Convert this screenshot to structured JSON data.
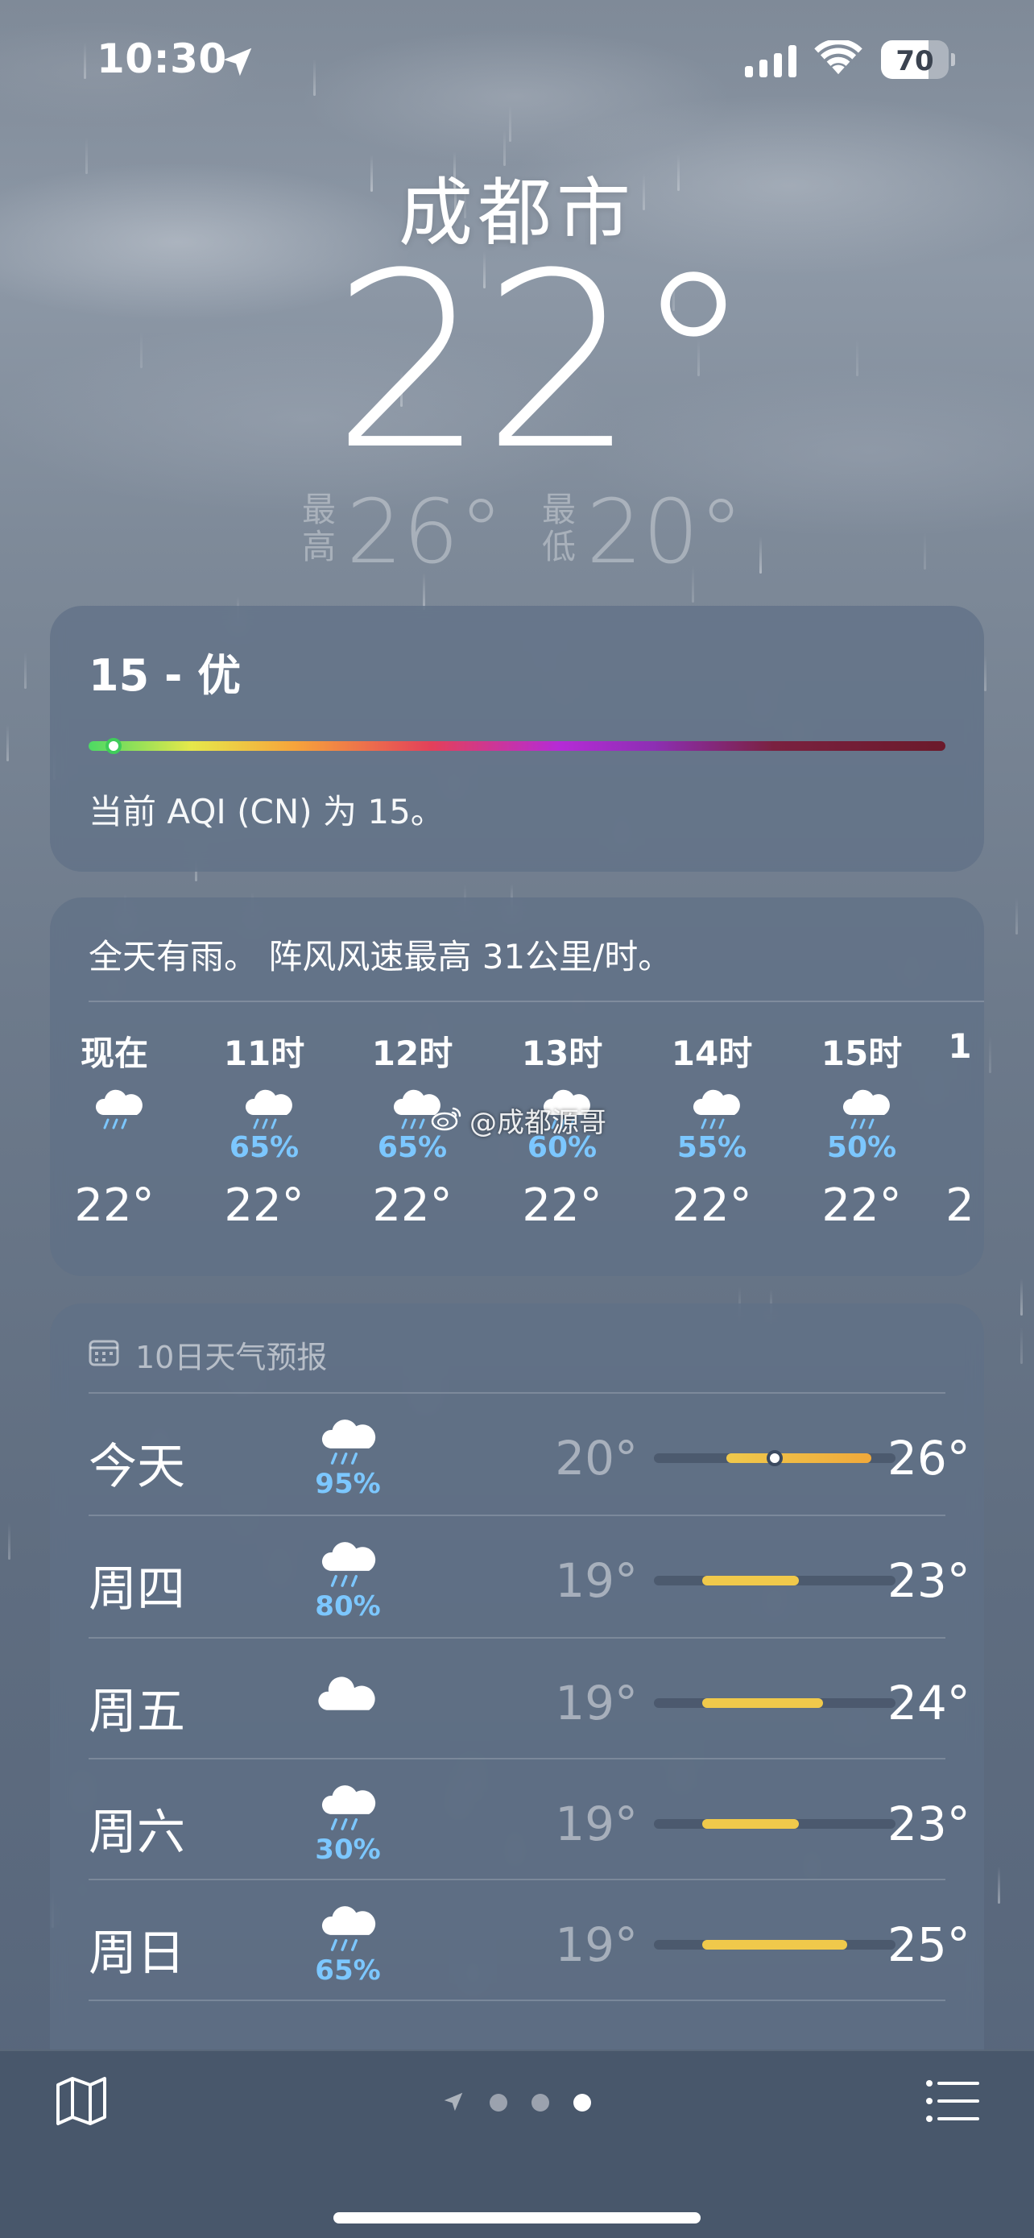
{
  "status_bar": {
    "time": "10:30",
    "battery": "70",
    "battery_level": 0.7,
    "icons": [
      "location-arrow-icon",
      "cellular-signal-icon",
      "wifi-icon",
      "battery-icon"
    ]
  },
  "current": {
    "city": "成都市",
    "temperature": "22°",
    "high_label": "最高",
    "high": "26°",
    "low_label": "最低",
    "low": "20°"
  },
  "aqi": {
    "title": "15 - 优",
    "description": "当前 AQI (CN) 为 15。",
    "indicator_fraction": 0.02
  },
  "hourly": {
    "summary": "全天有雨。 阵风风速最高 31公里/时。",
    "hours": [
      {
        "label": "现在",
        "pop": "",
        "temp": "22°",
        "icon": "rain-cloud-icon"
      },
      {
        "label": "11时",
        "pop": "65%",
        "temp": "22°",
        "icon": "rain-cloud-icon"
      },
      {
        "label": "12时",
        "pop": "65%",
        "temp": "22°",
        "icon": "rain-cloud-icon"
      },
      {
        "label": "13时",
        "pop": "60%",
        "temp": "22°",
        "icon": "rain-cloud-icon"
      },
      {
        "label": "14时",
        "pop": "55%",
        "temp": "22°",
        "icon": "rain-cloud-icon"
      },
      {
        "label": "15时",
        "pop": "50%",
        "temp": "22°",
        "icon": "rain-cloud-icon"
      },
      {
        "label": "1",
        "pop": "",
        "temp": "2",
        "icon": ""
      }
    ]
  },
  "watermark": "@成都源哥",
  "daily": {
    "header": "10日天气预报",
    "days": [
      {
        "name": "今天",
        "pop": "95%",
        "low": "20°",
        "high": "26°",
        "low_val": 20,
        "high_val": 26,
        "now_val": 22,
        "icon": "rain-cloud-icon"
      },
      {
        "name": "周四",
        "pop": "80%",
        "low": "19°",
        "high": "23°",
        "low_val": 19,
        "high_val": 23,
        "icon": "rain-cloud-icon"
      },
      {
        "name": "周五",
        "pop": "",
        "low": "19°",
        "high": "24°",
        "low_val": 19,
        "high_val": 24,
        "icon": "cloud-icon"
      },
      {
        "name": "周六",
        "pop": "30%",
        "low": "19°",
        "high": "23°",
        "low_val": 19,
        "high_val": 23,
        "icon": "rain-cloud-icon"
      },
      {
        "name": "周日",
        "pop": "65%",
        "low": "19°",
        "high": "25°",
        "low_val": 19,
        "high_val": 25,
        "icon": "rain-cloud-icon"
      }
    ],
    "scale_min": 17,
    "scale_max": 27
  },
  "bottom_bar": {
    "pages": 3,
    "active_page": 2,
    "icons": [
      "map-icon",
      "location-arrow-icon",
      "list-icon"
    ]
  },
  "colors": {
    "precip_blue": "#7cc7ff",
    "temp_bar": "#f0c94b"
  }
}
